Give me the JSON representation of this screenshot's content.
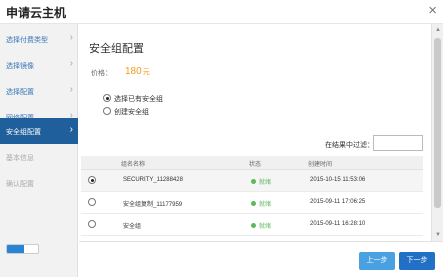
{
  "dialog": {
    "title": "申请云主机",
    "close": "×"
  },
  "sidebar": {
    "steps": [
      {
        "label": "选择付费类型"
      },
      {
        "label": "选择镜像"
      },
      {
        "label": "选择配置"
      },
      {
        "label": "网络配置"
      },
      {
        "label": "安全组配置"
      },
      {
        "label": "基本信息"
      },
      {
        "label": "确认配置"
      }
    ],
    "active_index": 4,
    "progress_fraction": 0.55,
    "arrow": "›"
  },
  "main": {
    "title": "安全组配置",
    "price_label": "价格：",
    "price_value": "180",
    "price_unit": "元",
    "options": [
      {
        "label": "选择已有安全组",
        "selected": true
      },
      {
        "label": "创建安全组",
        "selected": false
      }
    ],
    "filter_label": "在结果中过滤：",
    "filter_value": ""
  },
  "table": {
    "headers": [
      "",
      "组名名称",
      "状态",
      "创建时间"
    ],
    "rows": [
      {
        "selected": true,
        "name": "SECURITY_11288428",
        "status": "就绪",
        "created": "2015-10-15 11:53:06"
      },
      {
        "selected": false,
        "name": "安全组复制_11177959",
        "status": "就绪",
        "created": "2015-09-11 17:06:25"
      },
      {
        "selected": false,
        "name": "安全组",
        "status": "就绪",
        "created": "2015-09-11 16:28:10"
      }
    ]
  },
  "footer": {
    "prev_label": "上一步",
    "next_label": "下一步"
  },
  "colors": {
    "accent": "#1f5f9c",
    "price": "#f39a1c",
    "status_ok": "#5cb85c",
    "button": "#2270c5"
  },
  "scroll": {
    "up": "▲",
    "down": "▼"
  }
}
